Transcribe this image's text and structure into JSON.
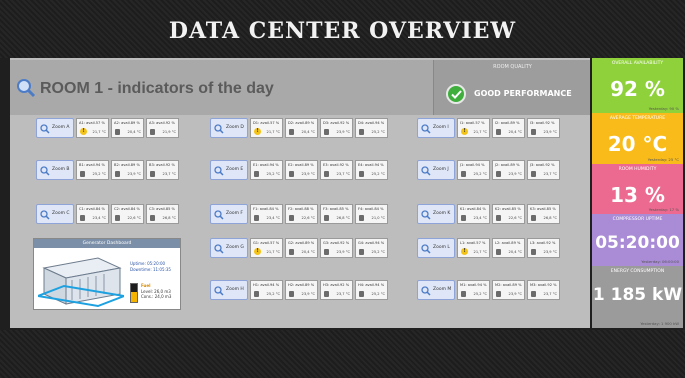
{
  "title": "DATA CENTER OVERVIEW",
  "room": {
    "title": "ROOM 1 - indicators of the day"
  },
  "quality": {
    "label": "ROOM QUALITY",
    "status": "GOOD PERFORMANCE"
  },
  "zones": [
    {
      "label": "Zoom A",
      "cells": [
        {
          "avail": "A1: avail.57 %",
          "temp": "21,7 °C",
          "warn": true
        },
        {
          "avail": "A2: avail.89 %",
          "temp": "20,4 °C"
        },
        {
          "avail": "A3: avail.92 %",
          "temp": "21,9 °C"
        }
      ]
    },
    {
      "label": "Zoom B",
      "cells": [
        {
          "avail": "B1: avail.94 %",
          "temp": "25,2 °C"
        },
        {
          "avail": "B2: avail.89 %",
          "temp": "23,9 °C"
        },
        {
          "avail": "B3: avail.92 %",
          "temp": "23,7 °C"
        }
      ]
    },
    {
      "label": "Zoom C",
      "cells": [
        {
          "avail": "C1: avail.84 %",
          "temp": "23,4 °C"
        },
        {
          "avail": "C2: avail.84 %",
          "temp": "22,6 °C"
        },
        {
          "avail": "C3: avail.85 %",
          "temp": "26,8 °C"
        }
      ]
    },
    {
      "label": "Zoom D",
      "cells": [
        {
          "avail": "D1: avail.57 %",
          "temp": "21,7 °C",
          "warn": true
        },
        {
          "avail": "D2: avail.89 %",
          "temp": "20,4 °C"
        },
        {
          "avail": "D3: avail.92 %",
          "temp": "23,9 °C"
        },
        {
          "avail": "D4: avail.94 %",
          "temp": "25,2 °C"
        }
      ]
    },
    {
      "label": "Zoom E",
      "cells": [
        {
          "avail": "E1: avail.94 %",
          "temp": "25,2 °C"
        },
        {
          "avail": "E2: avail.89 %",
          "temp": "23,9 °C"
        },
        {
          "avail": "E3: avail.92 %",
          "temp": "23,7 °C"
        },
        {
          "avail": "E4: avail.94 %",
          "temp": "25,2 °C"
        }
      ]
    },
    {
      "label": "Zoom F",
      "cells": [
        {
          "avail": "F1: avail.84 %",
          "temp": "23,4 °C"
        },
        {
          "avail": "F2: avail.88 %",
          "temp": "22,6 °C"
        },
        {
          "avail": "F3: avail.85 %",
          "temp": "26,8 °C"
        },
        {
          "avail": "F4: avail.84 %",
          "temp": "21,0 °C"
        }
      ]
    },
    {
      "label": "Zoom G",
      "cells": [
        {
          "avail": "G1: avail.57 %",
          "temp": "21,7 °C",
          "warn": true
        },
        {
          "avail": "G2: avail.89 %",
          "temp": "20,4 °C"
        },
        {
          "avail": "G3: avail.92 %",
          "temp": "23,9 °C"
        },
        {
          "avail": "G4: avail.94 %",
          "temp": "25,2 °C"
        }
      ]
    },
    {
      "label": "Zoom H",
      "cells": [
        {
          "avail": "H1: avail.94 %",
          "temp": "25,2 °C"
        },
        {
          "avail": "H2: avail.89 %",
          "temp": "23,9 °C"
        },
        {
          "avail": "H3: avail.92 %",
          "temp": "23,7 °C"
        },
        {
          "avail": "H4: avail.94 %",
          "temp": "25,2 °C"
        }
      ]
    },
    {
      "label": "Zoom I",
      "cells": [
        {
          "avail": "I1: avail.57 %",
          "temp": "21,7 °C",
          "warn": true
        },
        {
          "avail": "I2: avail.89 %",
          "temp": "20,4 °C"
        },
        {
          "avail": "I3: avail.92 %",
          "temp": "23,9 °C"
        }
      ]
    },
    {
      "label": "Zoom J",
      "cells": [
        {
          "avail": "J1: avail.94 %",
          "temp": "25,2 °C"
        },
        {
          "avail": "J2: avail.89 %",
          "temp": "23,9 °C"
        },
        {
          "avail": "J3: avail.92 %",
          "temp": "23,7 °C"
        }
      ]
    },
    {
      "label": "Zoom K",
      "cells": [
        {
          "avail": "K1: avail.84 %",
          "temp": "23,4 °C"
        },
        {
          "avail": "K2: avail.85 %",
          "temp": "22,6 °C"
        },
        {
          "avail": "K3: avail.85 %",
          "temp": "26,8 °C"
        }
      ]
    },
    {
      "label": "Zoom L",
      "cells": [
        {
          "avail": "L1: avail.57 %",
          "temp": "21,7 °C",
          "warn": true
        },
        {
          "avail": "L2: avail.89 %",
          "temp": "20,4 °C"
        },
        {
          "avail": "L3: avail.92 %",
          "temp": "23,9 °C"
        }
      ]
    },
    {
      "label": "Zoom M",
      "cells": [
        {
          "avail": "M1: avail.94 %",
          "temp": "25,2 °C"
        },
        {
          "avail": "M2: avail.89 %",
          "temp": "23,9 °C"
        },
        {
          "avail": "M3: avail.92 %",
          "temp": "23,7 °C"
        }
      ]
    }
  ],
  "generator": {
    "title": "Generator Dashboard",
    "uptime": "Uptime: 05:20:00",
    "downtime": "Downtime: 11:05:35",
    "fuel_label": "Fuel",
    "level": "Level: 26,0 m3",
    "cons": "Cons.: 24,0 m3",
    "fuel_level": 0.55
  },
  "kpis": [
    {
      "label": "OVERALL AVAILABILITY",
      "value": "92 %",
      "yesterday": "Yesterday: 90 %",
      "color": "#8fd13a"
    },
    {
      "label": "AVERAGE TEMPERATURE",
      "value": "20 °C",
      "yesterday": "Yesterday: 25 °C",
      "color": "#f8bb1a"
    },
    {
      "label": "ROOM HUMIDITY",
      "value": "13 %",
      "yesterday": "Yesterday: 17 %",
      "color": "#ec6a90"
    },
    {
      "label": "COMPRESSOR UPTIME",
      "value": "05:20:00",
      "yesterday": "Yesterday: 06:00:00",
      "color": "#a98bd6"
    },
    {
      "label": "ENERGY CONSUMPTION",
      "value": "1 185 kW",
      "yesterday": "Yesterday: 1 900 kW",
      "color": "#9b9b9b"
    }
  ]
}
